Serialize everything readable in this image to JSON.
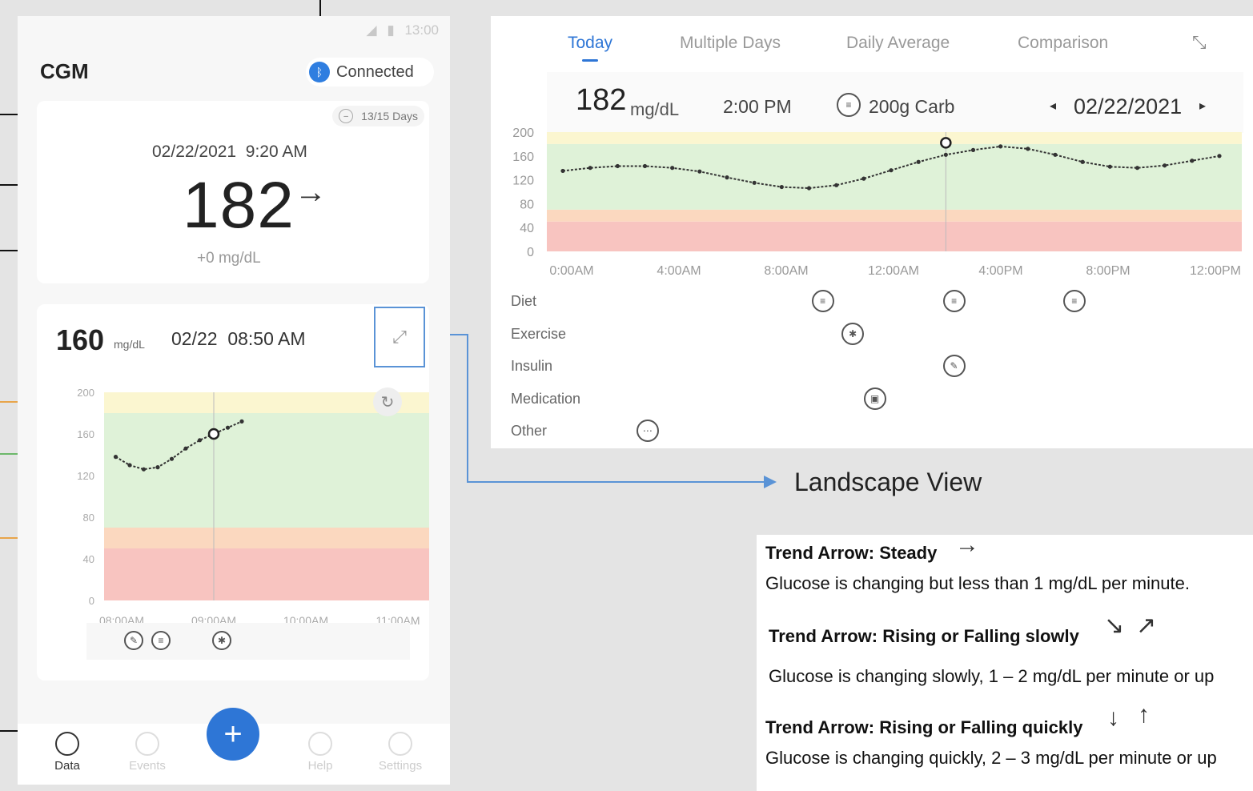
{
  "status_bar": {
    "time": "13:00"
  },
  "app": {
    "title": "CGM",
    "connection": "Connected",
    "bluetooth_icon": "bluetooth-icon"
  },
  "current": {
    "days": "13/15 Days",
    "datetime": "02/22/2021  9:20 AM",
    "value": "182",
    "trend_arrow": "→",
    "delta": "+0 mg/dL"
  },
  "mini": {
    "value": "160",
    "unit": "mg/dL",
    "datetime": "02/22  08:50 AM",
    "chart_data": {
      "type": "line",
      "x": [
        "07:50",
        "08:00",
        "08:10",
        "08:20",
        "08:30",
        "08:40",
        "08:50",
        "09:00",
        "09:10",
        "09:20"
      ],
      "values": [
        138,
        130,
        126,
        128,
        136,
        146,
        154,
        160,
        166,
        172
      ],
      "selected": {
        "x": "09:00",
        "value": 160
      },
      "yticks": [
        0,
        40,
        80,
        120,
        160,
        200
      ],
      "ytick_labels": [
        "0",
        "40",
        "80",
        "120",
        "160",
        "200"
      ],
      "xticks": [
        "08:00AM",
        "09:00AM",
        "10:00AM",
        "11:00AM"
      ],
      "ylim": [
        0,
        200
      ],
      "bands": [
        {
          "from": 0,
          "to": 50,
          "color": "#f8c4c0"
        },
        {
          "from": 50,
          "to": 70,
          "color": "#fbd8bf"
        },
        {
          "from": 70,
          "to": 180,
          "color": "#dff2d8"
        },
        {
          "from": 180,
          "to": 200,
          "color": "#fbf6d0"
        }
      ]
    }
  },
  "nav": {
    "data": "Data",
    "events": "Events",
    "help": "Help",
    "settings": "Settings",
    "add": "+"
  },
  "landscape": {
    "tabs": [
      "Today",
      "Multiple Days",
      "Daily Average",
      "Comparison"
    ],
    "summary": {
      "value": "182",
      "unit": "mg/dL",
      "time": "2:00 PM",
      "carb": "200g Carb",
      "date": "02/22/2021",
      "prev": "◂",
      "next": "▸"
    },
    "chart_data": {
      "type": "line",
      "x_hours": [
        0,
        1,
        2,
        3,
        4,
        5,
        6,
        7,
        8,
        9,
        10,
        11,
        12,
        13,
        14,
        15,
        16,
        17,
        18,
        19,
        20,
        21,
        22,
        23,
        24
      ],
      "values": [
        135,
        140,
        143,
        143,
        140,
        134,
        124,
        115,
        108,
        106,
        111,
        122,
        136,
        150,
        162,
        170,
        176,
        172,
        162,
        150,
        142,
        140,
        144,
        152,
        160
      ],
      "selected": {
        "x_hour": 14,
        "value": 182
      },
      "yticks": [
        0,
        40,
        80,
        120,
        160,
        200
      ],
      "ytick_labels": [
        "0",
        "40",
        "80",
        "120",
        "160",
        "200"
      ],
      "xticks": [
        "0:00AM",
        "4:00AM",
        "8:00AM",
        "12:00AM",
        "4:00PM",
        "8:00PM",
        "12:00PM"
      ],
      "ylim": [
        0,
        200
      ]
    },
    "event_rows": [
      "Diet",
      "Exercise",
      "Insulin",
      "Medication",
      "Other"
    ],
    "events": [
      {
        "row": 0,
        "hour": 9.5,
        "icon": "food-icon"
      },
      {
        "row": 0,
        "hour": 14.3,
        "icon": "food-icon"
      },
      {
        "row": 0,
        "hour": 18.7,
        "icon": "food-icon"
      },
      {
        "row": 1,
        "hour": 10.6,
        "icon": "exercise-icon"
      },
      {
        "row": 2,
        "hour": 14.3,
        "icon": "insulin-icon"
      },
      {
        "row": 3,
        "hour": 11.4,
        "icon": "medication-icon"
      },
      {
        "row": 4,
        "hour": 3.1,
        "icon": "more-icon"
      }
    ]
  },
  "landscape_label": "Landscape View",
  "legend": {
    "steady_title": "Trend Arrow: Steady",
    "steady_text": "Glucose is changing but less than 1 mg/dL per minute.",
    "slow_title": "Trend Arrow: Rising or Falling slowly",
    "slow_text": "Glucose is changing slowly, 1 – 2 mg/dL per minute or up",
    "quick_title": "Trend Arrow: Rising or Falling quickly",
    "quick_text": "Glucose is changing quickly, 2 – 3 mg/dL per minute or up",
    "arrow_steady": "→",
    "arrow_slow_down": "↘",
    "arrow_slow_up": "↗",
    "arrow_quick_down": "↓",
    "arrow_quick_up": "↑"
  },
  "colors": {
    "accent": "#2e76d6",
    "callout_blue": "#5a93d6",
    "callout_orange": "#e8a54a",
    "callout_green": "#6cb86a"
  }
}
